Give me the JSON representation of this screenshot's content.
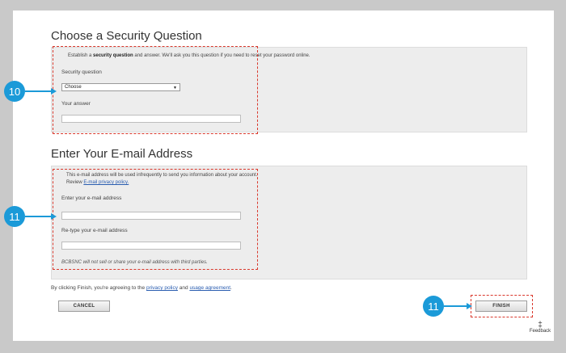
{
  "security": {
    "title": "Choose a Security Question",
    "desc_pre": "Establish a ",
    "desc_bold": "security question",
    "desc_post": " and answer. We'll ask you this question if you need to reset your password online.",
    "question_label": "Security question",
    "question_value": "Choose",
    "answer_label": "Your answer",
    "answer_value": ""
  },
  "email": {
    "title": "Enter Your E-mail Address",
    "desc": "This e-mail address will be used infrequently to send you information about your account.",
    "review_pre": "Review ",
    "review_link": "E-mail privacy policy.",
    "email_label": "Enter your e-mail address",
    "email_value": "",
    "retype_label": "Re-type your e-mail address",
    "retype_value": "",
    "disclaimer": "BCBSNC will not sell or share your e-mail address with third parties."
  },
  "footer": {
    "agree_pre": "By clicking Finish, you're agreeing to the ",
    "privacy_link": "privacy policy",
    "agree_mid": " and ",
    "usage_link": "usage agreement",
    "agree_post": ".",
    "cancel_label": "CANCEL",
    "finish_label": "FINISH",
    "feedback_label": "Feedback",
    "feedback_icon": "‡"
  },
  "callouts": {
    "step_security": "10",
    "step_email": "11",
    "step_finish": "11"
  },
  "colors": {
    "callout": "#1b9ad8",
    "highlight": "#d9382c",
    "link": "#2a5db0"
  }
}
